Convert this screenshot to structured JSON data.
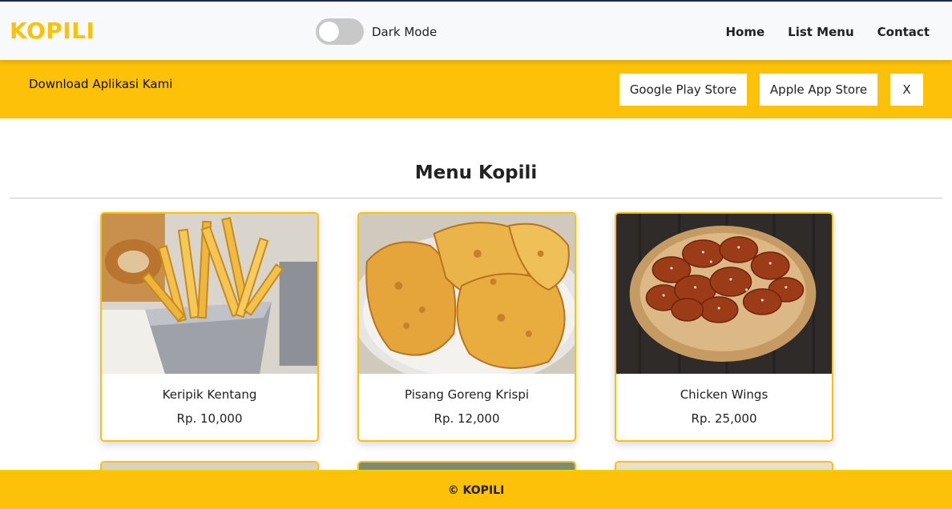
{
  "header": {
    "brand": "KOPILI",
    "dark_mode_label": "Dark Mode",
    "dark_mode_on": false,
    "nav": [
      "Home",
      "List Menu",
      "Contact"
    ]
  },
  "banner": {
    "text": "Download Aplikasi Kami",
    "google_play": "Google Play Store",
    "apple_store": "Apple App Store",
    "close": "X"
  },
  "main": {
    "title": "Menu Kopili",
    "items": [
      {
        "name": "Keripik Kentang",
        "price": "Rp. 10,000",
        "image": "fries-photo"
      },
      {
        "name": "Pisang Goreng Krispi",
        "price": "Rp. 12,000",
        "image": "fried-banana-photo"
      },
      {
        "name": "Chicken Wings",
        "price": "Rp. 25,000",
        "image": "chicken-wings-photo"
      }
    ]
  },
  "footer": {
    "text": "© KOPILI"
  },
  "colors": {
    "accent": "#fcc108",
    "navbar_bg": "#f8f9fa"
  }
}
